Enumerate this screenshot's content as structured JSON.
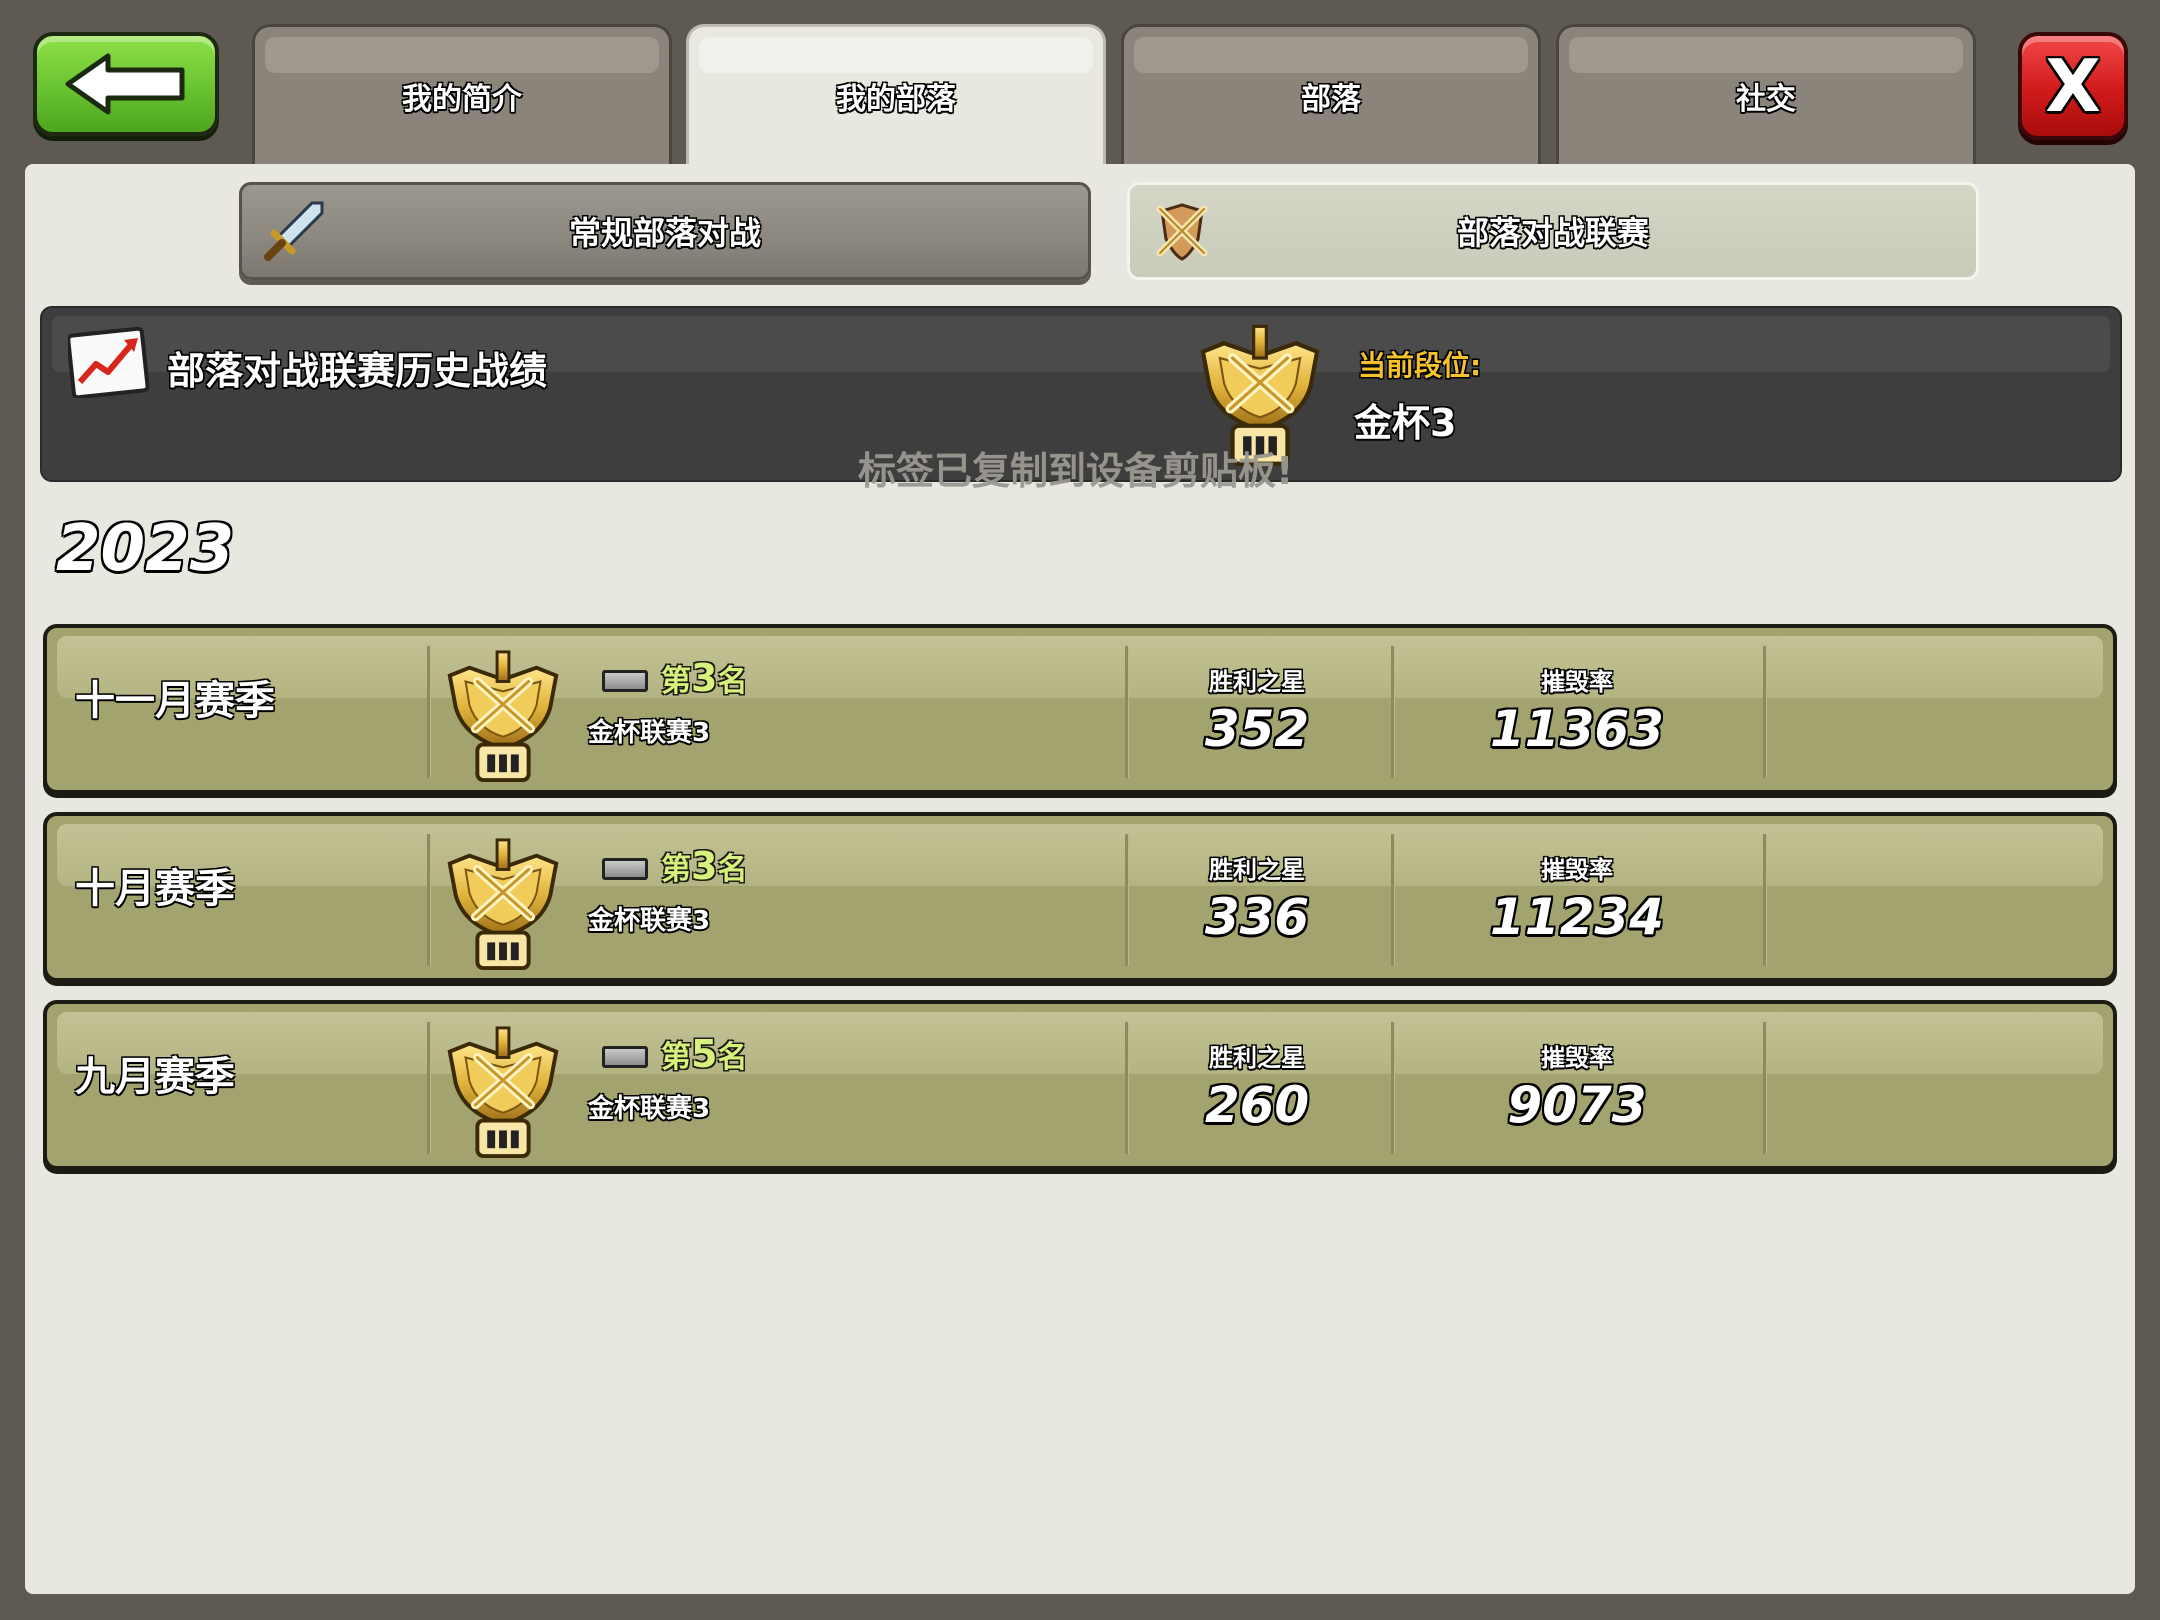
{
  "tabs": [
    {
      "label": "我的简介",
      "active": false
    },
    {
      "label": "我的部落",
      "active": true
    },
    {
      "label": "部落",
      "active": false
    },
    {
      "label": "社交",
      "active": false
    }
  ],
  "close_label": "X",
  "subtabs": {
    "regular": "常规部落对战",
    "league": "部落对战联赛"
  },
  "history": {
    "title": "部落对战联赛历史战绩",
    "current_label": "当前段位:",
    "current_value": "金杯3",
    "toast": "标签已复制到设备剪贴板!"
  },
  "year": "2023",
  "stat_headers": {
    "stars": "胜利之星",
    "destruction": "摧毁率"
  },
  "seasons": [
    {
      "name": "十一月赛季",
      "rank_prefix": "第",
      "rank": "3",
      "rank_suffix": "名",
      "league": "金杯联赛3",
      "stars": "352",
      "destruction": "11363"
    },
    {
      "name": "十月赛季",
      "rank_prefix": "第",
      "rank": "3",
      "rank_suffix": "名",
      "league": "金杯联赛3",
      "stars": "336",
      "destruction": "11234"
    },
    {
      "name": "九月赛季",
      "rank_prefix": "第",
      "rank": "5",
      "rank_suffix": "名",
      "league": "金杯联赛3",
      "stars": "260",
      "destruction": "9073"
    }
  ],
  "colors": {
    "back_button": "#6cc632",
    "close_button": "#d11a1a",
    "rank_text": "#d8f07c",
    "current_label": "#f6c22b",
    "season_row": "#a3a370"
  },
  "icons": {
    "back": "arrow-left-icon",
    "regular_war": "sword-icon",
    "league_war": "crossed-swords-shield-icon",
    "history": "chart-up-icon",
    "league_badge": "gold-league-trophy-icon"
  }
}
